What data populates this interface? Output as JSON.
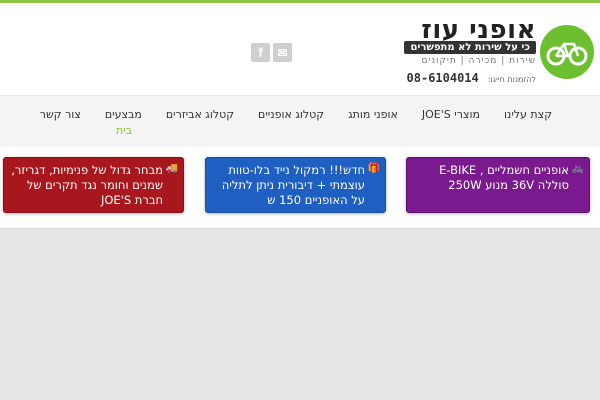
{
  "brand": {
    "title": "אופני עוז",
    "tagline": "כי על שירות לא מתפשרים",
    "services": "שירות | מכירה | תיקונים",
    "phone_label": "להזמנות חייגו:",
    "phone": "08-6104014",
    "accent_color": "#6cbf2f"
  },
  "social": {
    "facebook_glyph": "f",
    "email_glyph": "✉"
  },
  "nav": {
    "items": [
      {
        "label": "קצת עלינו"
      },
      {
        "label": "מוצרי JOE'S"
      },
      {
        "label": "אופני מותג"
      },
      {
        "label": "קטלוג אופניים"
      },
      {
        "label": "קטלוג אביזרים"
      },
      {
        "label": "מבצעים"
      },
      {
        "label": "צור קשר"
      }
    ],
    "home_label": "בית"
  },
  "promos": [
    {
      "color": "#7b1a8e",
      "icon": "🚲",
      "text": "אופניים חשמליים , E-BIKE סוללה 36V מנוע 250W"
    },
    {
      "color": "#1f5fc2",
      "icon": "🎁",
      "text": "חדש!!! רמקול נייד בלו-טוות עוצמתי + דיבורית ניתן לתליה על האופניים 150 ש"
    },
    {
      "color": "#a8171d",
      "icon": "🚚",
      "text": "מבחר גדול של פנימיות, דגריזר, שמנים וחומר נגד תקרים של חברת JOE'S"
    }
  ]
}
